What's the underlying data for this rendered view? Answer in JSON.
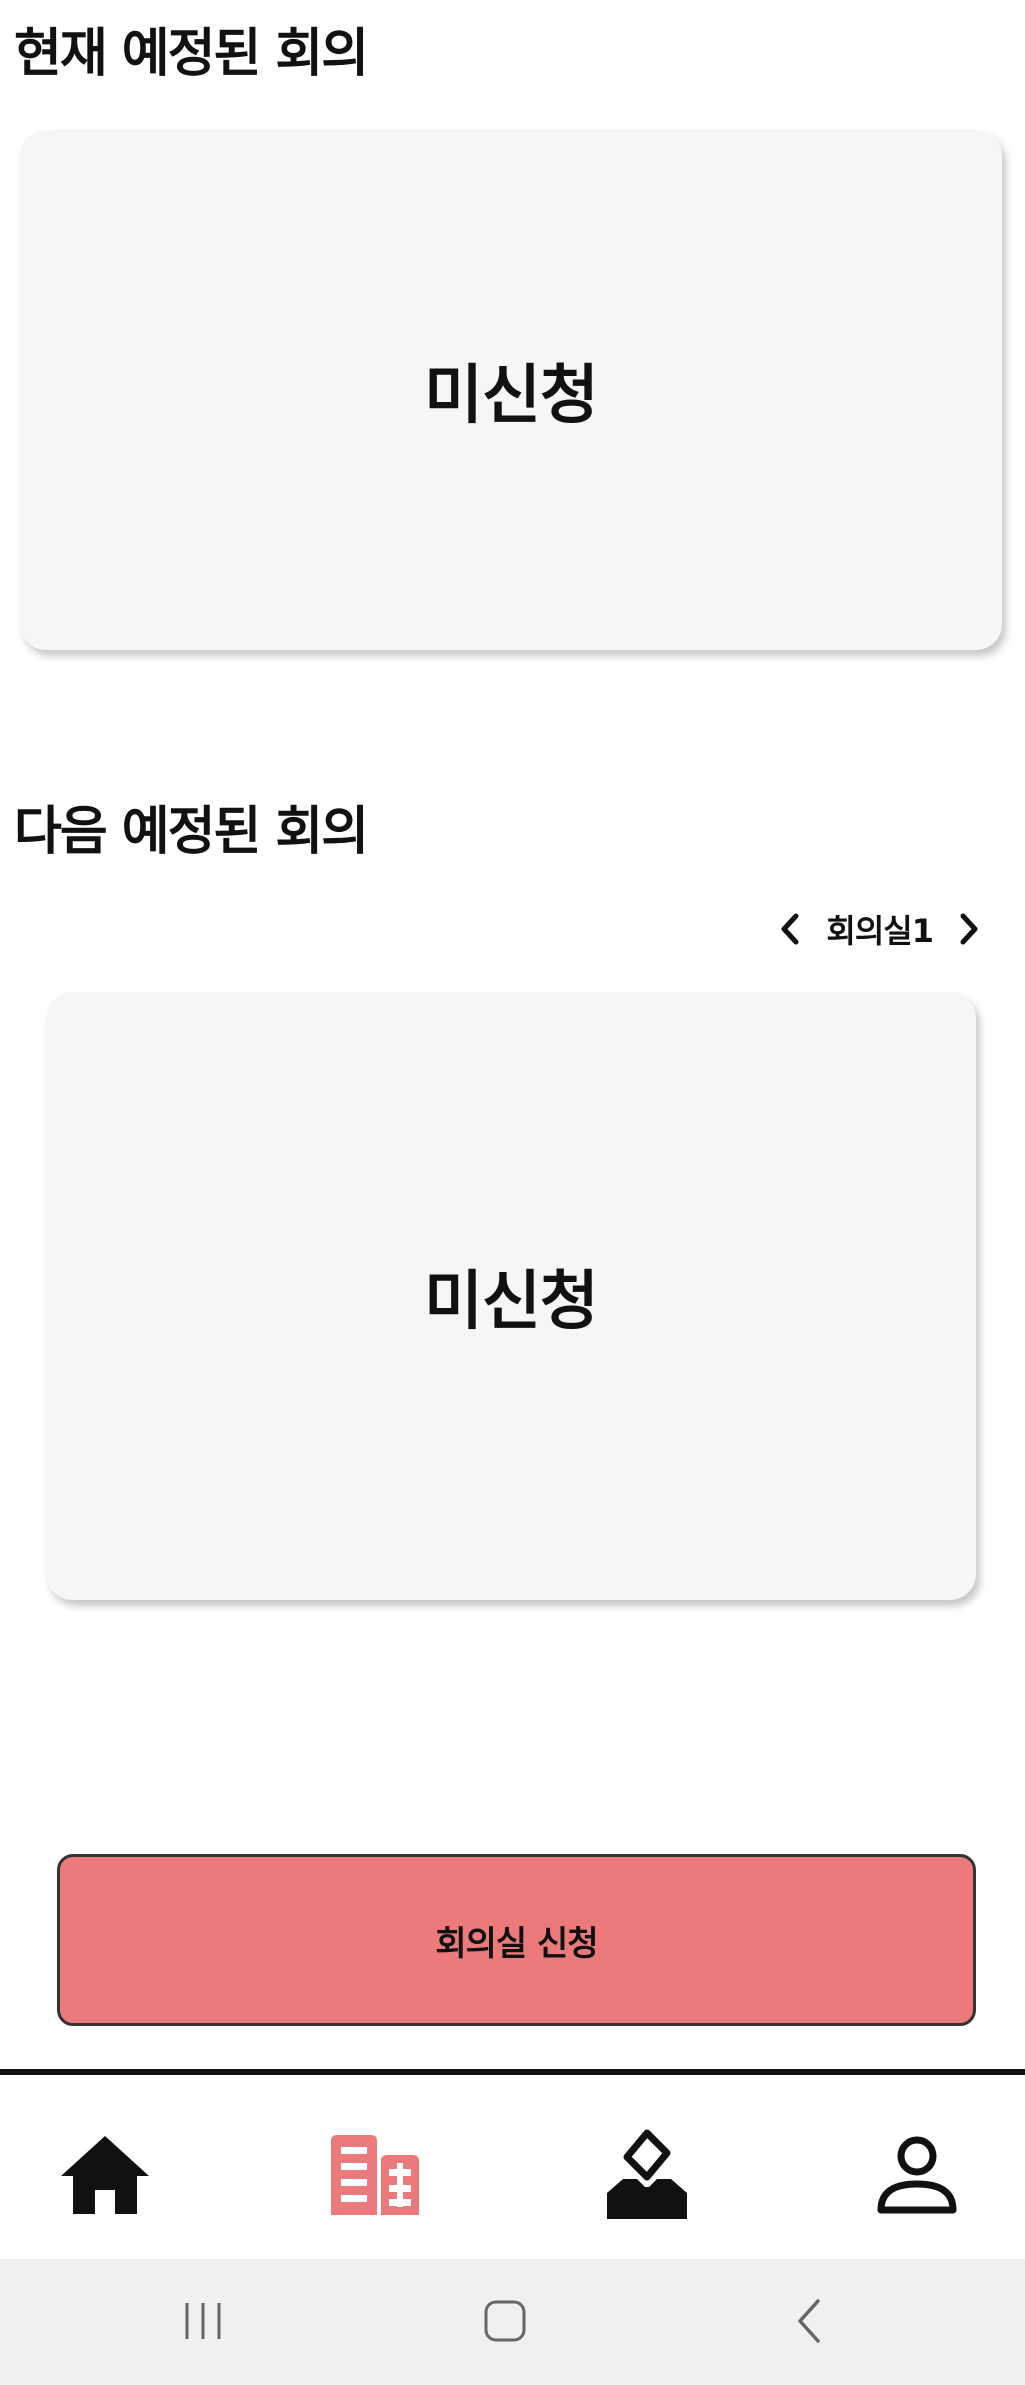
{
  "sections": {
    "current": {
      "title": "현재 예정된 회의",
      "status": "미신청"
    },
    "next": {
      "title": "다음 예정된 회의",
      "room": "회의실1",
      "status": "미신청"
    }
  },
  "apply_button": {
    "label": "회의실 신청"
  },
  "tabbar": {
    "items": [
      {
        "icon": "home-icon",
        "active": false
      },
      {
        "icon": "building-icon",
        "active": true
      },
      {
        "icon": "ballot-box-icon",
        "active": false
      },
      {
        "icon": "user-icon",
        "active": false
      }
    ]
  },
  "colors": {
    "accent": "#ec7a7b",
    "card": "#f6f6f6",
    "text": "#111111",
    "system_bar": "#f0f0f0"
  }
}
